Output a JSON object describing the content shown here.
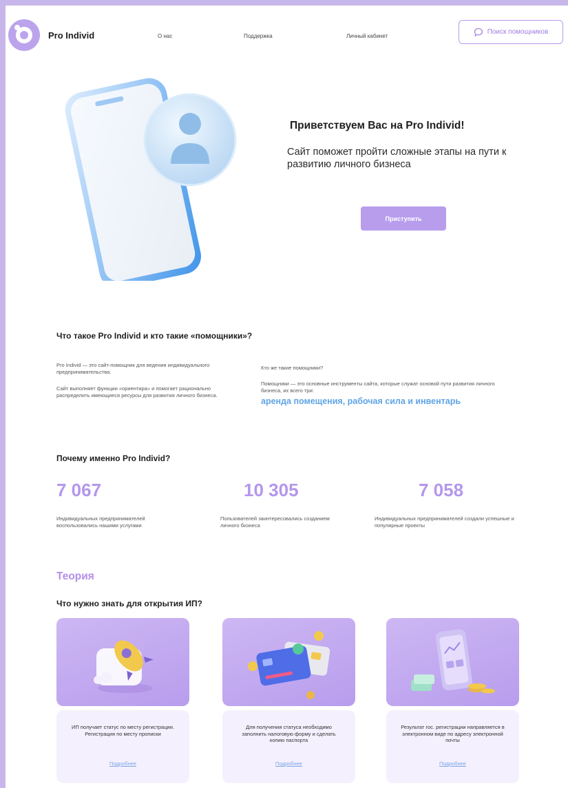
{
  "header": {
    "brand": "Pro Individ",
    "nav": [
      "О нас",
      "Поддержка",
      "Личный кабинет"
    ],
    "search_button": "Поиск помощников"
  },
  "hero": {
    "title": "Приветствуем Вас на Pro Individ!",
    "subtitle": "Сайт поможет пройти сложные этапы на пути к развитию личного бизнеса",
    "cta": "Приступить"
  },
  "about": {
    "title": "Что такое Pro Individ и кто такие «помощники»?",
    "left_p1": "Pro Individ — это сайт-помощник для ведения индивидуального предпринимательства.",
    "left_p2": "Сайт выполняет функции «ориентира» и помогает рационально распределить имеющиеся ресурсы для развития личного бизнеса.",
    "right_q": "Кто же такие помощники?",
    "right_p": "Помощники — это основные инструменты сайта, которые служат основой пути развития личного бизнеса, их всего три:",
    "highlight": "аренда помещения, рабочая сила и инвентарь"
  },
  "why": {
    "title": "Почему именно Pro Individ?",
    "stats": [
      {
        "value": "7 067",
        "text": "Индивидуальных предпринимателей воспользовались нашими услугами"
      },
      {
        "value": "10 305",
        "text": "Пользователей заинтересовались созданием личного бизнеса"
      },
      {
        "value": "7 058",
        "text": "Индивидуальных предпринимателей создали успешные и популярные проекты"
      }
    ]
  },
  "theory": {
    "label": "Теория",
    "title": "Что нужно знать для открытия ИП?",
    "cards": [
      {
        "text": "ИП получает статус по месту регистрации. Регистрация по месту прописки",
        "link": "Подробнее",
        "icon": "rocket-icon"
      },
      {
        "text": "Для получения статуса необходимо заполнить налоговую форму и сделать копию паспорта",
        "link": "Подробнее",
        "icon": "credit-card-icon"
      },
      {
        "text": "Результат гос. регистрации направляется в электронном виде по адресу электронной почты",
        "link": "Подробнее",
        "icon": "phone-money-icon"
      }
    ]
  },
  "colors": {
    "accent": "#b89ded",
    "accent_text": "#b48ee8",
    "highlight": "#5fa4e6",
    "frame": "#c7b6ea"
  }
}
